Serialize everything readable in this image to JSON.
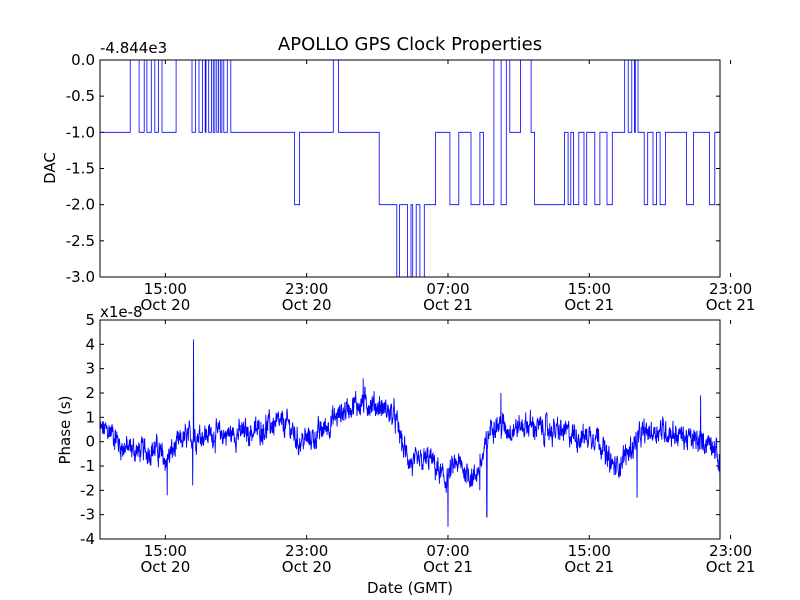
{
  "title": "APOLLO GPS Clock Properties",
  "chart_data": [
    {
      "type": "line",
      "title": "APOLLO GPS Clock Properties",
      "offset_label": "-4.844e3",
      "ylabel": "DAC",
      "xlabel": "",
      "ylim": [
        -3.0,
        0.0
      ],
      "yticks": [
        -3.0,
        -2.5,
        -2.0,
        -1.5,
        -1.0,
        -0.5,
        0.0
      ],
      "ytick_labels": [
        "-3.0",
        "-2.5",
        "-2.0",
        "-1.5",
        "-1.0",
        "-0.5",
        "0.0"
      ],
      "x_unit": "hours from 2011-10-20 00:00 GMT",
      "xlim": [
        11.3,
        46.4
      ],
      "xticks": [
        15,
        23,
        31,
        39,
        47
      ],
      "xtick_labels": [
        {
          "time": "15:00",
          "date": "Oct 20"
        },
        {
          "time": "23:00",
          "date": "Oct 20"
        },
        {
          "time": "07:00",
          "date": "Oct 21"
        },
        {
          "time": "15:00",
          "date": "Oct 21"
        },
        {
          "time": "23:00",
          "date": "Oct 21"
        }
      ],
      "line_color": "#0000ff",
      "grid": false,
      "series": [
        {
          "style": "step",
          "baseline": -1.0,
          "segments": [
            {
              "x0": 11.3,
              "x1": 22.3,
              "y": -1.0
            },
            {
              "x0": 22.3,
              "x1": 22.6,
              "y": -2.0
            },
            {
              "x0": 22.6,
              "x1": 23.0,
              "y": -1.0
            },
            {
              "x0": 23.0,
              "x1": 25.3,
              "y": -1.0
            },
            {
              "x0": 25.3,
              "x1": 27.1,
              "y": -1.0
            },
            {
              "x0": 27.1,
              "x1": 28.1,
              "y": -2.0
            },
            {
              "x0": 28.1,
              "x1": 29.3,
              "y": -2.0
            },
            {
              "x0": 29.3,
              "x1": 29.7,
              "y": -2.0
            },
            {
              "x0": 29.7,
              "x1": 30.3,
              "y": -2.0
            },
            {
              "x0": 30.3,
              "x1": 31.1,
              "y": -1.0
            },
            {
              "x0": 31.1,
              "x1": 31.6,
              "y": -2.0
            },
            {
              "x0": 31.6,
              "x1": 33.0,
              "y": -1.0
            },
            {
              "x0": 33.0,
              "x1": 34.4,
              "y": -2.0
            },
            {
              "x0": 34.4,
              "x1": 35.9,
              "y": -1.0
            },
            {
              "x0": 35.9,
              "x1": 37.6,
              "y": -2.0
            },
            {
              "x0": 37.6,
              "x1": 39.1,
              "y": -1.0
            },
            {
              "x0": 39.1,
              "x1": 40.3,
              "y": -1.0
            },
            {
              "x0": 40.3,
              "x1": 40.9,
              "y": -1.0
            },
            {
              "x0": 40.9,
              "x1": 43.8,
              "y": -1.0
            },
            {
              "x0": 43.8,
              "x1": 45.9,
              "y": -1.0
            },
            {
              "x0": 45.9,
              "x1": 46.4,
              "y": -1.0
            }
          ],
          "glitches": [
            {
              "t": 13.0,
              "w": 0.5,
              "y": 0.0
            },
            {
              "t": 13.8,
              "w": 0.15,
              "y": 0.0
            },
            {
              "t": 14.2,
              "w": 0.2,
              "y": 0.0
            },
            {
              "t": 14.6,
              "w": 0.2,
              "y": 0.0
            },
            {
              "t": 15.6,
              "w": 0.9,
              "y": 0.0
            },
            {
              "t": 16.7,
              "w": 0.2,
              "y": 0.0
            },
            {
              "t": 17.1,
              "w": 0.15,
              "y": 0.0
            },
            {
              "t": 17.3,
              "w": 0.15,
              "y": 0.0
            },
            {
              "t": 17.6,
              "w": 0.1,
              "y": 0.0
            },
            {
              "t": 17.8,
              "w": 0.1,
              "y": 0.0
            },
            {
              "t": 18.0,
              "w": 0.1,
              "y": 0.0
            },
            {
              "t": 18.2,
              "w": 0.1,
              "y": 0.0
            },
            {
              "t": 18.5,
              "w": 0.2,
              "y": 0.0
            },
            {
              "t": 22.3,
              "w": 0.3,
              "y": -2.0
            },
            {
              "t": 24.5,
              "w": 0.3,
              "y": 0.0
            },
            {
              "t": 28.1,
              "w": 0.15,
              "y": -3.0
            },
            {
              "t": 28.4,
              "w": 0.15,
              "y": -2.0
            },
            {
              "t": 28.7,
              "w": 0.2,
              "y": -3.0
            },
            {
              "t": 29.0,
              "w": 0.2,
              "y": -3.0
            },
            {
              "t": 29.4,
              "w": 0.25,
              "y": -3.0
            },
            {
              "t": 29.8,
              "w": 0.2,
              "y": -2.0
            },
            {
              "t": 31.1,
              "w": 0.4,
              "y": -2.0
            },
            {
              "t": 32.3,
              "w": 0.5,
              "y": -2.0
            },
            {
              "t": 33.6,
              "w": 0.4,
              "y": 0.0
            },
            {
              "t": 34.3,
              "w": 0.2,
              "y": 0.0
            },
            {
              "t": 35.1,
              "w": 0.6,
              "y": 0.0
            },
            {
              "t": 37.4,
              "w": 0.2,
              "y": -2.0
            },
            {
              "t": 37.8,
              "w": 0.15,
              "y": -2.0
            },
            {
              "t": 38.1,
              "w": 0.3,
              "y": -2.0
            },
            {
              "t": 38.7,
              "w": 0.15,
              "y": -2.0
            },
            {
              "t": 39.3,
              "w": 0.3,
              "y": -2.0
            },
            {
              "t": 40.0,
              "w": 0.3,
              "y": -2.0
            },
            {
              "t": 41.0,
              "w": 0.2,
              "y": 0.0
            },
            {
              "t": 41.4,
              "w": 0.15,
              "y": 0.0
            },
            {
              "t": 41.6,
              "w": 0.15,
              "y": 0.0
            },
            {
              "t": 42.1,
              "w": 0.2,
              "y": -2.0
            },
            {
              "t": 42.6,
              "w": 0.2,
              "y": -2.0
            },
            {
              "t": 43.0,
              "w": 0.3,
              "y": -2.0
            },
            {
              "t": 44.5,
              "w": 0.4,
              "y": -2.0
            },
            {
              "t": 45.8,
              "w": 0.3,
              "y": -2.0
            }
          ]
        }
      ]
    },
    {
      "type": "line",
      "title": "",
      "offset_label": "x1e-8",
      "ylabel": "Phase (s)",
      "xlabel": "Date (GMT)",
      "ylim": [
        -4,
        5
      ],
      "yticks": [
        -4,
        -3,
        -2,
        -1,
        0,
        1,
        2,
        3,
        4,
        5
      ],
      "ytick_labels": [
        "-4",
        "-3",
        "-2",
        "-1",
        "0",
        "1",
        "2",
        "3",
        "4",
        "5"
      ],
      "x_unit": "hours from 2011-10-20 00:00 GMT",
      "xlim": [
        11.3,
        46.4
      ],
      "xticks": [
        15,
        23,
        31,
        39,
        47
      ],
      "xtick_labels": [
        {
          "time": "15:00",
          "date": "Oct 20"
        },
        {
          "time": "23:00",
          "date": "Oct 20"
        },
        {
          "time": "07:00",
          "date": "Oct 21"
        },
        {
          "time": "15:00",
          "date": "Oct 21"
        },
        {
          "time": "23:00",
          "date": "Oct 21"
        }
      ],
      "line_color": "#0000ff",
      "grid": false,
      "series": [
        {
          "style": "noisy",
          "envelope": [
            {
              "t": 11.3,
              "v": 0.5
            },
            {
              "t": 12.0,
              "v": 0.4
            },
            {
              "t": 12.5,
              "v": -0.2
            },
            {
              "t": 13.5,
              "v": -0.4
            },
            {
              "t": 14.5,
              "v": -0.3
            },
            {
              "t": 15.0,
              "v": -0.8
            },
            {
              "t": 15.5,
              "v": -0.3
            },
            {
              "t": 16.0,
              "v": 0.1
            },
            {
              "t": 17.0,
              "v": 0.3
            },
            {
              "t": 18.5,
              "v": 0.3
            },
            {
              "t": 20.0,
              "v": 0.4
            },
            {
              "t": 21.0,
              "v": 0.7
            },
            {
              "t": 22.0,
              "v": 0.7
            },
            {
              "t": 22.5,
              "v": 0.0
            },
            {
              "t": 23.5,
              "v": 0.2
            },
            {
              "t": 24.5,
              "v": 0.9
            },
            {
              "t": 25.5,
              "v": 1.5
            },
            {
              "t": 26.5,
              "v": 1.6
            },
            {
              "t": 27.5,
              "v": 1.3
            },
            {
              "t": 28.0,
              "v": 1.0
            },
            {
              "t": 28.5,
              "v": -0.3
            },
            {
              "t": 29.0,
              "v": -1.0
            },
            {
              "t": 30.0,
              "v": -0.7
            },
            {
              "t": 30.8,
              "v": -1.6
            },
            {
              "t": 31.5,
              "v": -0.9
            },
            {
              "t": 32.5,
              "v": -1.5
            },
            {
              "t": 33.0,
              "v": -0.6
            },
            {
              "t": 33.5,
              "v": 0.8
            },
            {
              "t": 34.5,
              "v": 0.5
            },
            {
              "t": 35.5,
              "v": 0.7
            },
            {
              "t": 36.5,
              "v": 0.5
            },
            {
              "t": 37.5,
              "v": 0.4
            },
            {
              "t": 38.5,
              "v": 0.2
            },
            {
              "t": 39.5,
              "v": 0.3
            },
            {
              "t": 40.0,
              "v": -0.7
            },
            {
              "t": 40.5,
              "v": -1.1
            },
            {
              "t": 41.0,
              "v": -0.6
            },
            {
              "t": 42.0,
              "v": 0.3
            },
            {
              "t": 43.0,
              "v": 0.5
            },
            {
              "t": 44.0,
              "v": 0.3
            },
            {
              "t": 45.0,
              "v": 0.0
            },
            {
              "t": 46.0,
              "v": 0.0
            },
            {
              "t": 46.4,
              "v": -1.0
            }
          ],
          "noise_amplitude": 0.35,
          "spikes": [
            {
              "t": 16.6,
              "v": 4.2
            },
            {
              "t": 16.55,
              "v": -1.8
            },
            {
              "t": 15.1,
              "v": -2.2
            },
            {
              "t": 31.0,
              "v": -3.5
            },
            {
              "t": 33.2,
              "v": -3.1
            },
            {
              "t": 32.8,
              "v": -2.0
            },
            {
              "t": 34.0,
              "v": 2.0
            },
            {
              "t": 26.2,
              "v": 2.6
            },
            {
              "t": 41.7,
              "v": -2.3
            },
            {
              "t": 45.3,
              "v": 1.9
            },
            {
              "t": 46.4,
              "v": -2.0
            }
          ]
        }
      ]
    }
  ]
}
